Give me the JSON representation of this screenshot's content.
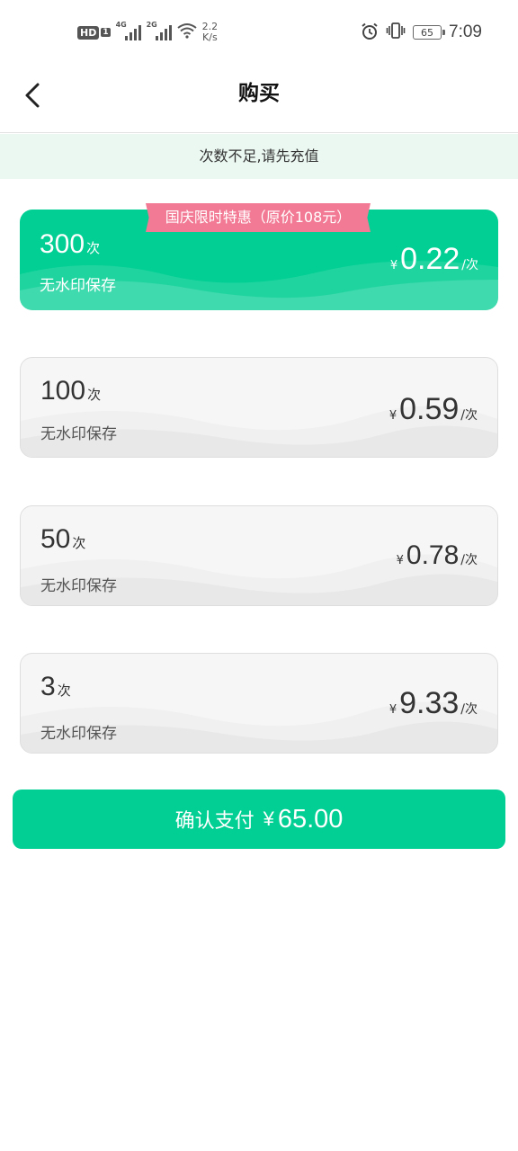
{
  "status_bar": {
    "hd": "HD",
    "hd_sub": "1",
    "net1": "4G",
    "net2": "2G",
    "speed_value": "2.2",
    "speed_unit": "K/s",
    "battery": "65",
    "time": "7:09"
  },
  "header": {
    "title": "购买",
    "back_icon": "chevron-left-icon"
  },
  "notice": "次数不足,请先充值",
  "promo_tag": "国庆限时特惠（原价108元）",
  "plans": [
    {
      "count": "300",
      "unit": "次",
      "desc": "无水印保存",
      "currency": "¥",
      "price": "0.22",
      "per": "/次",
      "selected": true
    },
    {
      "count": "100",
      "unit": "次",
      "desc": "无水印保存",
      "currency": "¥",
      "price": "0.59",
      "per": "/次",
      "selected": false
    },
    {
      "count": "50",
      "unit": "次",
      "desc": "无水印保存",
      "currency": "¥",
      "price": "0.78",
      "per": "/次",
      "selected": false
    },
    {
      "count": "3",
      "unit": "次",
      "desc": "无水印保存",
      "currency": "¥",
      "price": "9.33",
      "per": "/次",
      "selected": false
    }
  ],
  "confirm": {
    "label": "确认支付",
    "currency": "¥",
    "amount": "65.00"
  },
  "colors": {
    "accent": "#02cf93",
    "promo": "#f27a94",
    "notice_bg": "#ebf8f2"
  }
}
